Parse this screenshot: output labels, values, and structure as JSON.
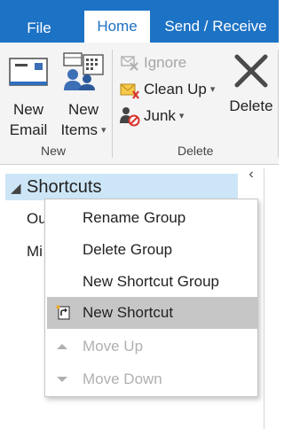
{
  "tabs": {
    "file": "File",
    "home": "Home",
    "send_receive": "Send / Receive"
  },
  "ribbon": {
    "new_group": {
      "new_email_line1": "New",
      "new_email_line2": "Email",
      "new_items_line1": "New",
      "new_items_line2": "Items",
      "label": "New"
    },
    "delete_group": {
      "ignore": "Ignore",
      "clean_up": "Clean Up",
      "junk": "Junk",
      "delete": "Delete",
      "label": "Delete"
    },
    "icons": {
      "new_email": "envelope-icon",
      "new_items": "calendar-people-icon",
      "ignore": "ignore-icon",
      "clean_up": "clean-up-icon",
      "junk": "junk-icon",
      "delete": "delete-x-icon"
    }
  },
  "nav": {
    "shortcuts_header": "Shortcuts",
    "items": [
      "Ou",
      "Mi"
    ]
  },
  "context_menu": {
    "items": [
      {
        "label": "Rename Group",
        "state": "normal"
      },
      {
        "label": "Delete Group",
        "state": "normal"
      },
      {
        "label": "New Shortcut Group",
        "state": "normal"
      },
      {
        "label": "New Shortcut",
        "state": "selected",
        "icon": "new-shortcut-icon"
      },
      {
        "label": "Move Up",
        "state": "disabled",
        "icon": "arrow-up-icon"
      },
      {
        "label": "Move Down",
        "state": "disabled",
        "icon": "arrow-down-icon"
      }
    ]
  },
  "colors": {
    "accent": "#1c72c4",
    "selection": "#cde6f7",
    "menu_selected": "#c6c6c6"
  }
}
